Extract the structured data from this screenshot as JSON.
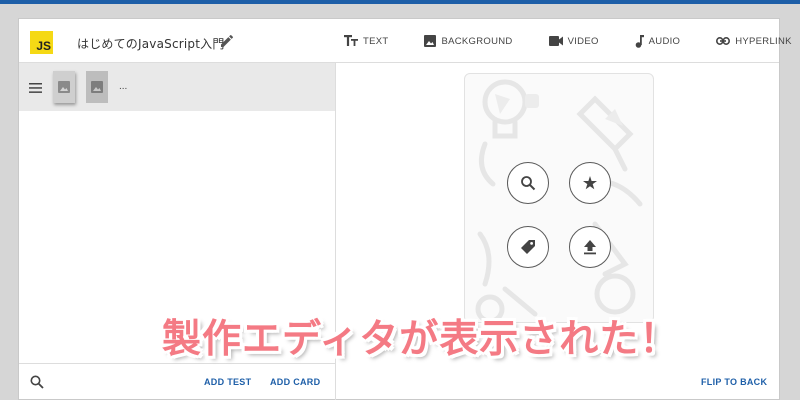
{
  "header": {
    "logo_text": "JS",
    "deck_title": "はじめてのJavaScript入門",
    "tools": [
      {
        "label": "TEXT",
        "icon": "text-icon"
      },
      {
        "label": "BACKGROUND",
        "icon": "image-icon"
      },
      {
        "label": "VIDEO",
        "icon": "video-icon"
      },
      {
        "label": "AUDIO",
        "icon": "music-note-icon"
      },
      {
        "label": "HYPERLINK",
        "icon": "link-icon"
      }
    ]
  },
  "left_panel": {
    "more_label": "...",
    "footer": {
      "add_test_label": "ADD TEST",
      "add_card_label": "ADD CARD"
    }
  },
  "right_panel": {
    "card_actions": [
      "search-icon",
      "magic-icon",
      "tag-icon",
      "upload-icon"
    ],
    "flip_label": "FLIP TO BACK"
  },
  "caption": "製作エディタが表示された！",
  "colors": {
    "accent": "#1e5fa8",
    "logo_bg": "#f5d915",
    "caption": "#f47a84"
  }
}
